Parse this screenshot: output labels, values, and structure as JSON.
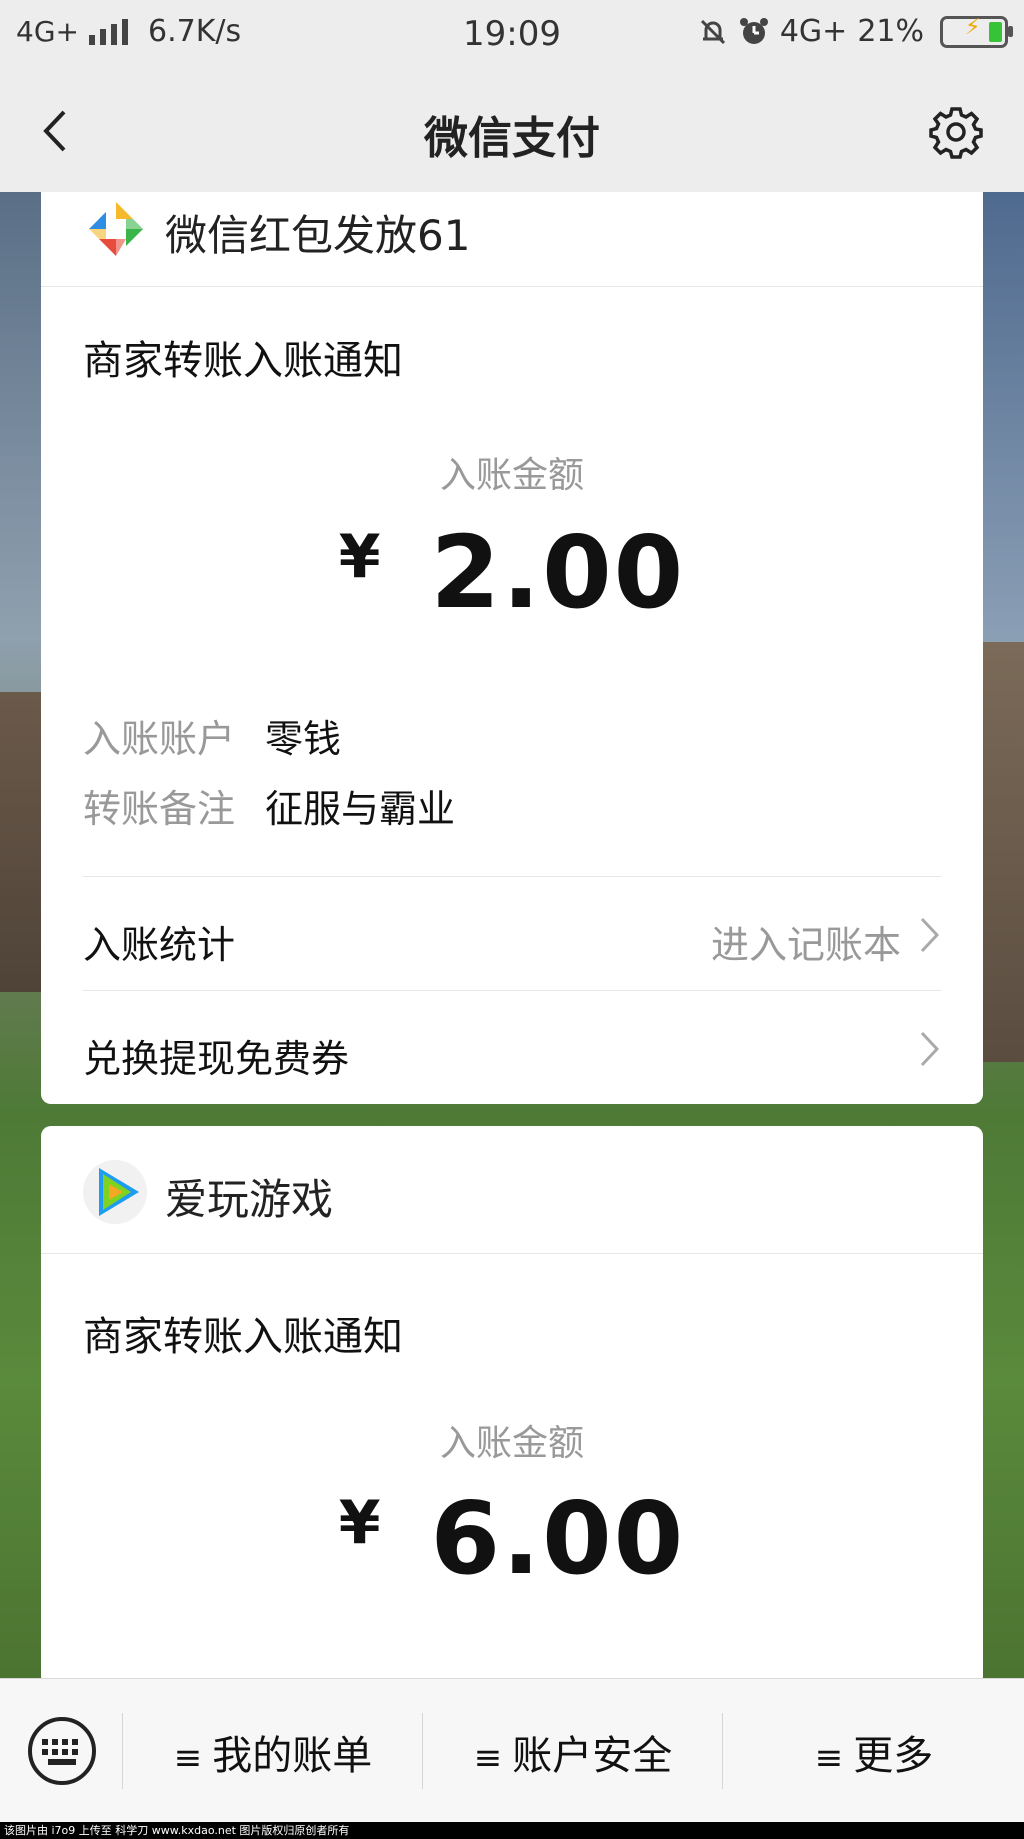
{
  "status_bar": {
    "network": "4G+",
    "speed": "6.7K/s",
    "time": "19:09",
    "network_right": "4G+",
    "battery": "21%"
  },
  "nav": {
    "title": "微信支付"
  },
  "cards": [
    {
      "app_name": "微信红包发放61",
      "logo_icon": "wechat-redpacket-logo",
      "notice_title": "商家转账入账通知",
      "amount_label": "入账金额",
      "currency": "¥",
      "amount": "2.00",
      "details": [
        {
          "key": "入账账户",
          "value": "零钱"
        },
        {
          "key": "转账备注",
          "value": "征服与霸业"
        }
      ],
      "links": [
        {
          "label": "入账统计",
          "extra": "进入记账本"
        },
        {
          "label": "兑换提现免费券",
          "extra": ""
        }
      ]
    },
    {
      "app_name": "爱玩游戏",
      "logo_icon": "play-logo",
      "notice_title": "商家转账入账通知",
      "amount_label": "入账金额",
      "currency": "¥",
      "amount": "6.00"
    }
  ],
  "bottom_menu": [
    {
      "label": "我的账单",
      "icon": "hamburger-icon"
    },
    {
      "label": "账户安全",
      "icon": "hamburger-icon"
    },
    {
      "label": "更多",
      "icon": "hamburger-icon"
    }
  ],
  "watermark": "该图片由 i7o9 上传至 科学刀 www.kxdao.net 图片版权归原创者所有",
  "colors": {
    "accent_green": "#37c337",
    "muted_text": "#999999",
    "card_bg": "#ffffff"
  }
}
